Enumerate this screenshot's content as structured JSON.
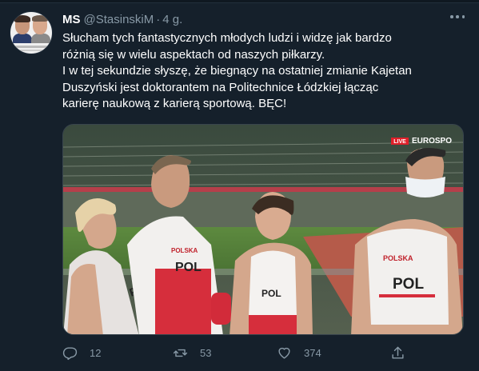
{
  "tweet": {
    "author_name": "MS",
    "author_handle": "@StasinskiM",
    "separator": "·",
    "time": "4 g.",
    "text_lines": [
      "Słucham tych fantastycznych młodych ludzi i widzę jak bardzo",
      "różnią się w wielu aspektach od naszych piłkarzy.",
      "I w tej sekundzie słyszę, że biegnący na ostatniej zmianie Kajetan",
      "Duszyński jest doktorantem na Politechnice Łódzkiej łącząc",
      "karierę naukową z karierą sportową. BĘC!"
    ],
    "media": {
      "live_badge": "LIVE",
      "broadcaster": "EUROSPO",
      "bibs": [
        "POL",
        "POL",
        "POL",
        "POL"
      ],
      "shirt_text": "POLSKA"
    },
    "stats": {
      "replies": "12",
      "retweets": "53",
      "likes": "374"
    }
  },
  "icons": {
    "reply": "reply-icon",
    "retweet": "retweet-icon",
    "like": "heart-icon",
    "share": "share-icon",
    "more": "more-icon"
  },
  "colors": {
    "background": "#15202b",
    "secondary_text": "#8899a6",
    "border": "#38444d"
  }
}
